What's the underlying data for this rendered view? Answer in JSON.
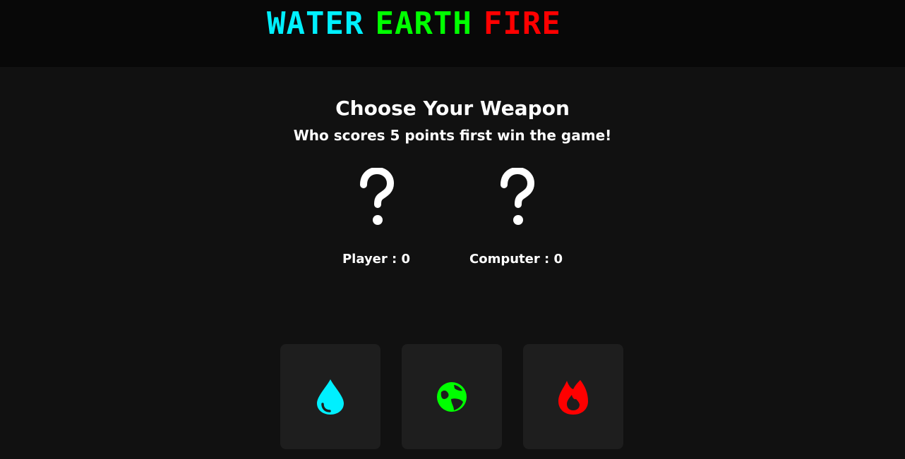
{
  "header": {
    "logo": [
      {
        "word": "WATER",
        "color": "#00f0ff"
      },
      {
        "word": "EARTH",
        "color": "#00ff00"
      },
      {
        "word": "FIRE",
        "color": "#ff0000"
      }
    ]
  },
  "main": {
    "title": "Choose Your Weapon",
    "subtitle": "Who scores 5 points first win the game!"
  },
  "scoreboard": {
    "player_label": "Player : 0",
    "computer_label": "Computer : 0",
    "player_score": 0,
    "computer_score": 0,
    "player_choice_icon": "question-mark-icon",
    "computer_choice_icon": "question-mark-icon"
  },
  "weapons": [
    {
      "name": "water",
      "icon": "water-drop-icon",
      "color": "#00f0ff"
    },
    {
      "name": "earth",
      "icon": "globe-icon",
      "color": "#00ff00"
    },
    {
      "name": "fire",
      "icon": "fire-icon",
      "color": "#ff0000"
    }
  ]
}
